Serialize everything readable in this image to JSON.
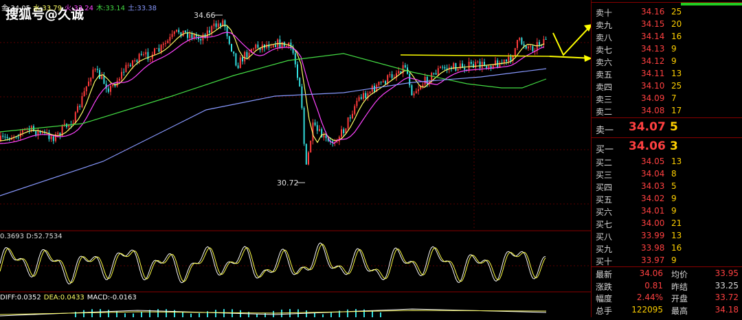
{
  "watermark": "搜狐号@久诚",
  "ma_legend": [
    {
      "text": "金:34.05",
      "color": "#ffffff"
    },
    {
      "text": "水:33.79",
      "color": "#ffff66"
    },
    {
      "text": "火:33.24",
      "color": "#ff44ff"
    },
    {
      "text": "木:33.14",
      "color": "#44dd44"
    },
    {
      "text": "土:33.38",
      "color": "#8899ff"
    }
  ],
  "price_high_label": "34.66",
  "price_low_label": "30.72",
  "oscillator_legend": "0.3693 D:52.7534",
  "macd_legend": [
    {
      "text": "DIFF:0.0352",
      "color": "#ffffff"
    },
    {
      "text": "DEA:0.0433",
      "color": "#ffff66"
    },
    {
      "text": "MACD:-0.0163",
      "color": "#ffffff"
    }
  ],
  "sell_levels": [
    {
      "label": "卖十",
      "price": "34.16",
      "vol": "25"
    },
    {
      "label": "卖九",
      "price": "34.15",
      "vol": "20"
    },
    {
      "label": "卖八",
      "price": "34.14",
      "vol": "16"
    },
    {
      "label": "卖七",
      "price": "34.13",
      "vol": "9"
    },
    {
      "label": "卖六",
      "price": "34.12",
      "vol": "9"
    },
    {
      "label": "卖五",
      "price": "34.11",
      "vol": "13"
    },
    {
      "label": "卖四",
      "price": "34.10",
      "vol": "25"
    },
    {
      "label": "卖三",
      "price": "34.09",
      "vol": "7"
    },
    {
      "label": "卖二",
      "price": "34.08",
      "vol": "17"
    }
  ],
  "sell_one": {
    "label": "卖一",
    "price": "34.07",
    "vol": "5"
  },
  "buy_one": {
    "label": "买一",
    "price": "34.06",
    "vol": "3"
  },
  "buy_levels": [
    {
      "label": "买二",
      "price": "34.05",
      "vol": "13"
    },
    {
      "label": "买三",
      "price": "34.04",
      "vol": "8"
    },
    {
      "label": "买四",
      "price": "34.03",
      "vol": "5"
    },
    {
      "label": "买五",
      "price": "34.02",
      "vol": "9"
    },
    {
      "label": "买六",
      "price": "34.01",
      "vol": "9"
    },
    {
      "label": "买七",
      "price": "34.00",
      "vol": "21"
    },
    {
      "label": "买八",
      "price": "33.99",
      "vol": "13"
    },
    {
      "label": "买九",
      "price": "33.98",
      "vol": "16"
    },
    {
      "label": "买十",
      "price": "33.97",
      "vol": "9"
    }
  ],
  "quote": [
    {
      "k1": "最新",
      "v1": "34.06",
      "c1": "#ff4040",
      "k2": "均价",
      "v2": "33.95",
      "c2": "#ff4040"
    },
    {
      "k1": "涨跌",
      "v1": "0.81",
      "c1": "#ff4040",
      "k2": "昨结",
      "v2": "33.25",
      "c2": "#d8d8d8"
    },
    {
      "k1": "幅度",
      "v1": "2.44%",
      "c1": "#ff4040",
      "k2": "开盘",
      "v2": "33.72",
      "c2": "#ff4040"
    },
    {
      "k1": "总手",
      "v1": "122095",
      "c1": "#ffd000",
      "k2": "最高",
      "v2": "34.18",
      "c2": "#ff4040"
    }
  ],
  "colors": {
    "up": "#ff3b3b",
    "down": "#33e0e0",
    "ma5": "#ffffff",
    "ma10": "#ffff66",
    "ma20": "#ff44ff",
    "ma60": "#44dd44",
    "ma120": "#8899ff",
    "arrow": "#ffff00"
  }
}
